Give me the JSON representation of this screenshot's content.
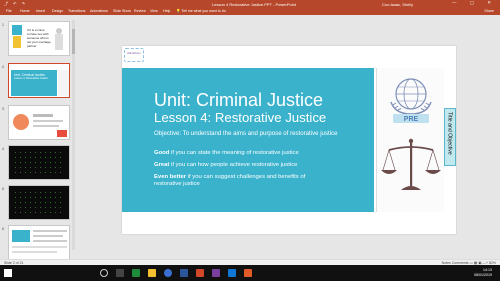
{
  "window": {
    "quick_access": "⤴ ↶ ↷",
    "doc_title": "Lesson 4 Restorative Justice.PPT - PowerPoint",
    "user": "Cox-Isaac, Shelly",
    "win_buttons": "—  ▢  ✕"
  },
  "ribbon": {
    "tabs": [
      "File",
      "Home",
      "Insert",
      "Design",
      "Transitions",
      "Animations",
      "Slide Show",
      "Review",
      "View",
      "Help"
    ],
    "tell_me": "Tell me what you want to do",
    "share": "Share"
  },
  "thumbnails": {
    "numbers": [
      "1",
      "2",
      "3",
      "4",
      "5",
      "6"
    ],
    "slide1_text": "If it is a crime to have sex with someone who is not your marriage partner",
    "slide2_title": "Unit: Criminal Justice",
    "slide2_sub": "Lesson 4: Restorative Justice"
  },
  "slide": {
    "logo_text": "RE Ethics",
    "title": "Unit: Criminal Justice",
    "subtitle": "Lesson 4: Restorative Justice",
    "objective": "Objective: To understand the aims and purpose of restorative justice",
    "good_label": "Good",
    "good_text": " if you can state the meaning of restorative justice",
    "great_label": "Great",
    "great_text": " if you can how people achieve restorative justice",
    "better_label": "Even better",
    "better_text": " if you can suggest challenges and benefits of",
    "better_text2": "restorative justice",
    "side_tab": "Title and Objective",
    "un_label": "PRE"
  },
  "status": {
    "left": "Slide 2 of 21",
    "right": "Notes   Comments   ▭ ▦ ▣   —+ 82%"
  },
  "taskbar": {
    "time": "14:13",
    "date": "08/01/2019"
  },
  "colors": {
    "ribbon": "#b7472a",
    "slide_blue": "#3ab2cc",
    "selected_border": "#d24726"
  }
}
